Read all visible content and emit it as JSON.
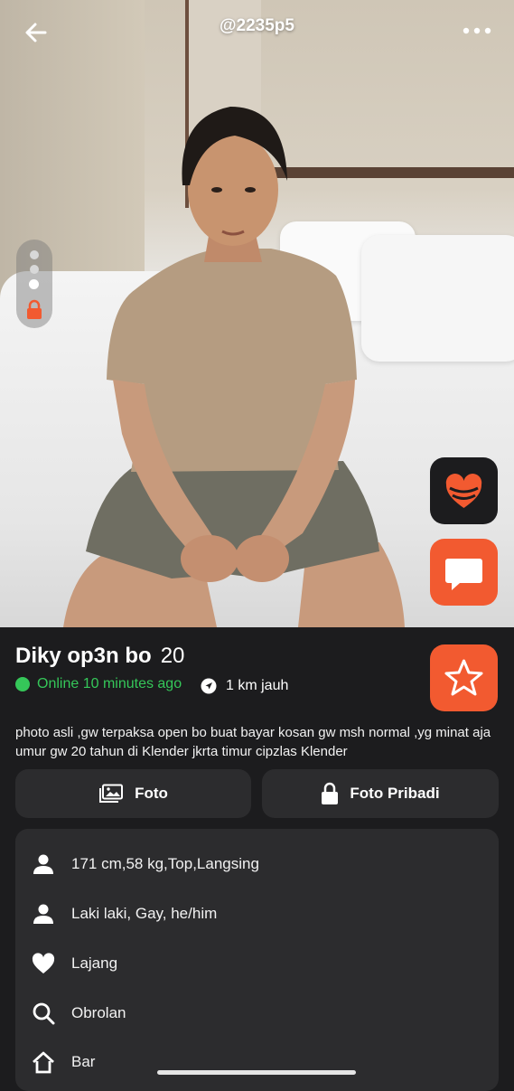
{
  "header": {
    "handle": "@2235p5"
  },
  "icons": {
    "back": "back-arrow-icon",
    "more": "more-dots-icon",
    "lock": "lock-icon",
    "heart": "heart-icon",
    "chat": "chat-bubble-icon",
    "star": "star-icon",
    "location": "location-arrow-icon",
    "photo": "photo-icon",
    "person": "person-icon",
    "search": "search-icon",
    "home": "home-icon"
  },
  "profile": {
    "name": "Diky op3n bo",
    "age": "20",
    "status": "Online 10 minutes ago",
    "distance": "1 km jauh",
    "bio": "photo asli ,gw terpaksa open bo buat bayar kosan gw msh normal ,yg minat aja umur gw 20 tahun di Klender jkrta timur cipzlas Klender"
  },
  "tabs": {
    "foto": "Foto",
    "foto_pribadi": "Foto Pribadi"
  },
  "info": [
    {
      "icon": "person-icon",
      "label": "171 cm,58 kg,Top,Langsing"
    },
    {
      "icon": "person-icon",
      "label": "Laki laki, Gay, he/him"
    },
    {
      "icon": "heart-icon",
      "label": "Lajang"
    },
    {
      "icon": "search-icon",
      "label": "Obrolan"
    },
    {
      "icon": "home-icon",
      "label": "Bar"
    }
  ],
  "colors": {
    "accent": "#f25a30",
    "online": "#35c759",
    "background": "#1c1c1e",
    "card": "#2c2c2e"
  }
}
